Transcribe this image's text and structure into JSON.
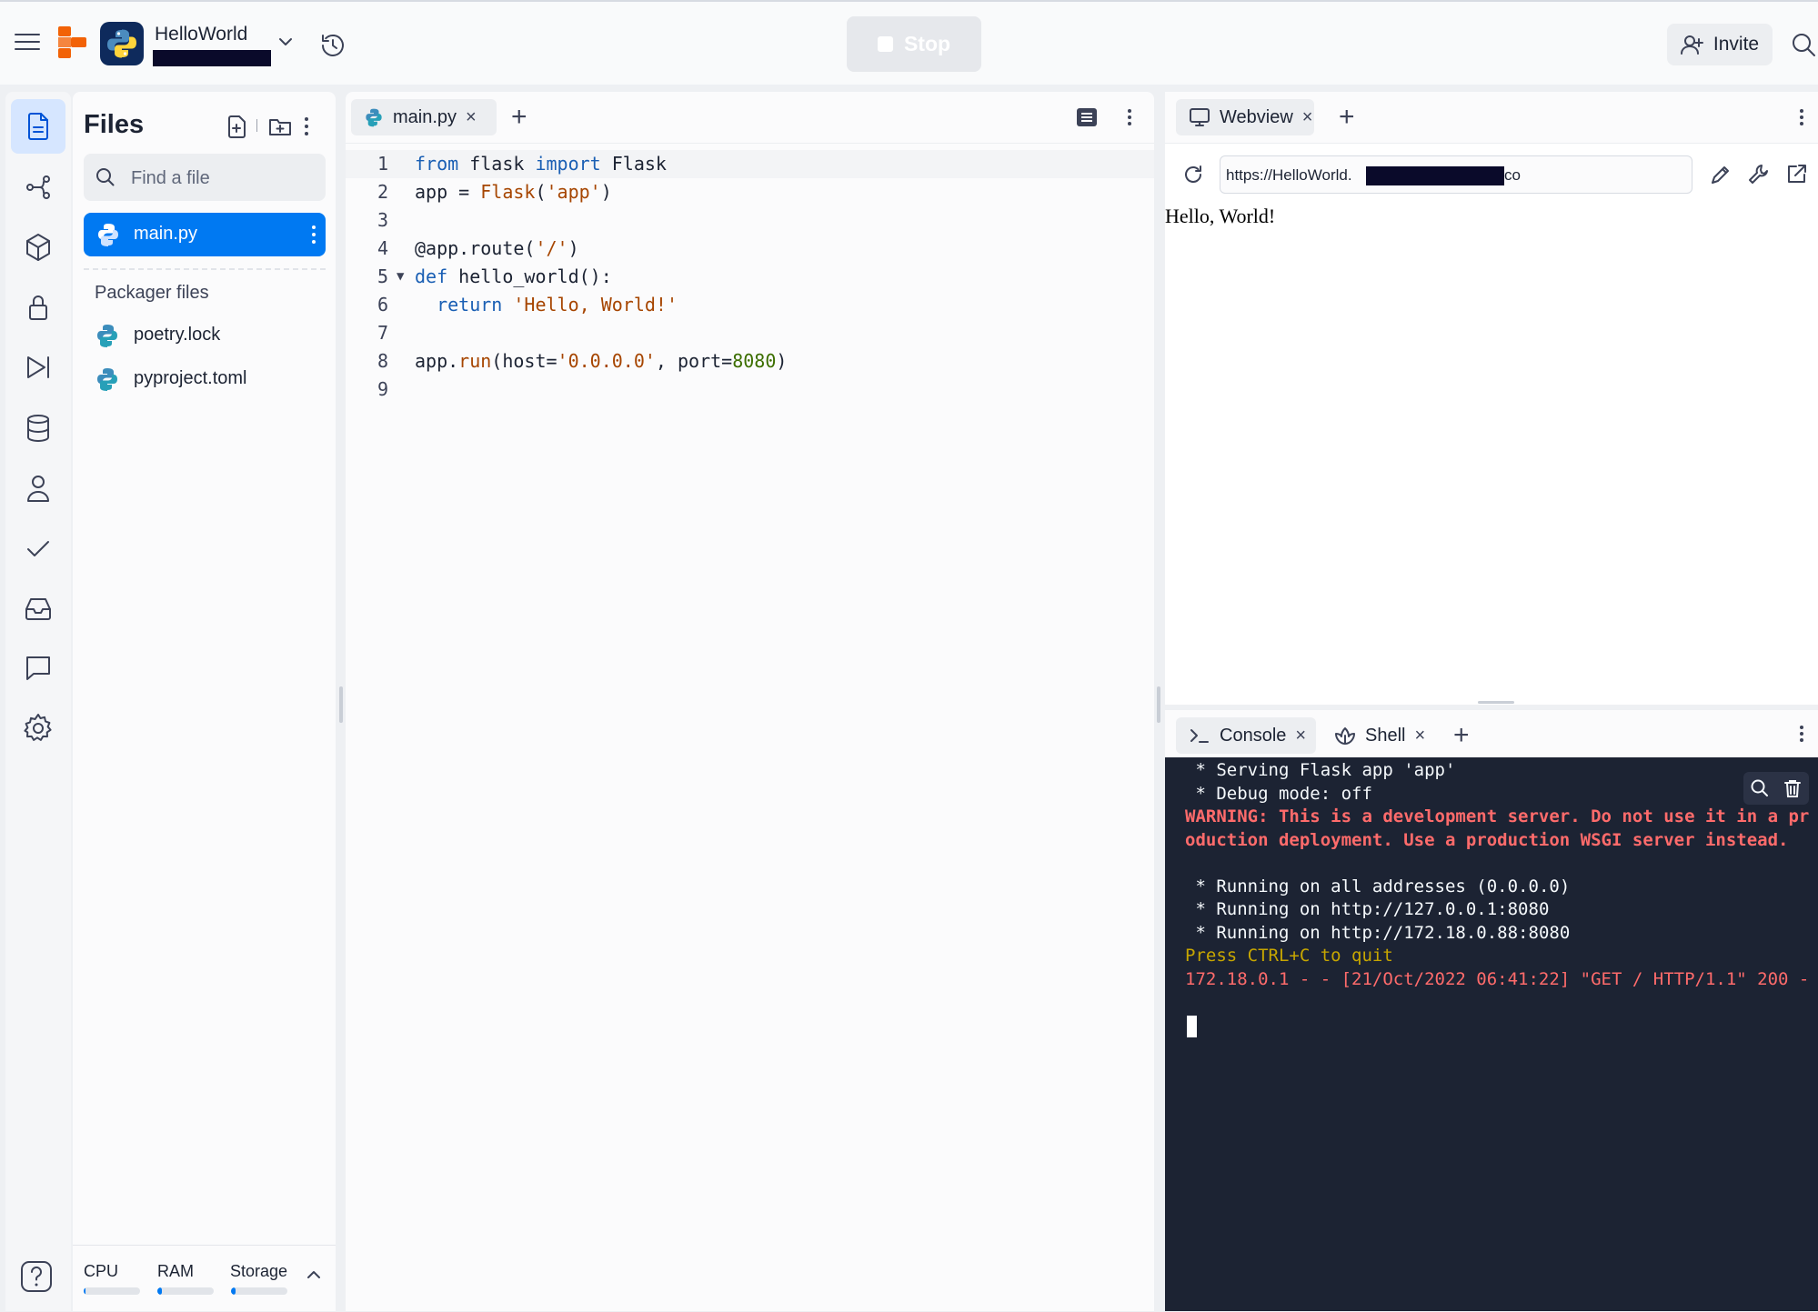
{
  "topbar": {
    "app_name": "HelloWorld",
    "stop_label": "Stop",
    "invite_label": "Invite"
  },
  "files": {
    "title": "Files",
    "search_placeholder": "Find a file",
    "active_file": "main.py",
    "packager_title": "Packager files",
    "packager_items": [
      "poetry.lock",
      "pyproject.toml"
    ]
  },
  "resources": {
    "cpu_label": "CPU",
    "cpu_usage": 0.03,
    "ram_label": "RAM",
    "ram_usage": 0.08,
    "storage_label": "Storage",
    "storage_usage": 0.08
  },
  "editor": {
    "tab_label": "main.py",
    "line_numbers": [
      "1",
      "2",
      "3",
      "4",
      "5",
      "6",
      "7",
      "8",
      "9"
    ]
  },
  "webview": {
    "tab_label": "Webview",
    "url_prefix": "https://HelloWorld.",
    "url_suffix": "co",
    "content": "Hello, World!"
  },
  "console": {
    "tab_console": "Console",
    "tab_shell": "Shell",
    "lines": [
      " * Serving Flask app 'app'",
      " * Debug mode: off",
      "WARNING: This is a development server. Do not use it in a production deployment. Use a production WSGI server instead.",
      " * Running on all addresses (0.0.0.0)",
      " * Running on http://127.0.0.1:8080",
      " * Running on http://172.18.0.88:8080",
      "Press CTRL+C to quit",
      "172.18.0.1 - - [21/Oct/2022 06:41:22] \"GET / HTTP/1.1\" 200 -"
    ]
  },
  "colors": {
    "accent": "#0079f2",
    "terminal_bg": "#1c2333",
    "warning_red": "#ff6b6b",
    "notice_yellow": "#c7a600"
  }
}
